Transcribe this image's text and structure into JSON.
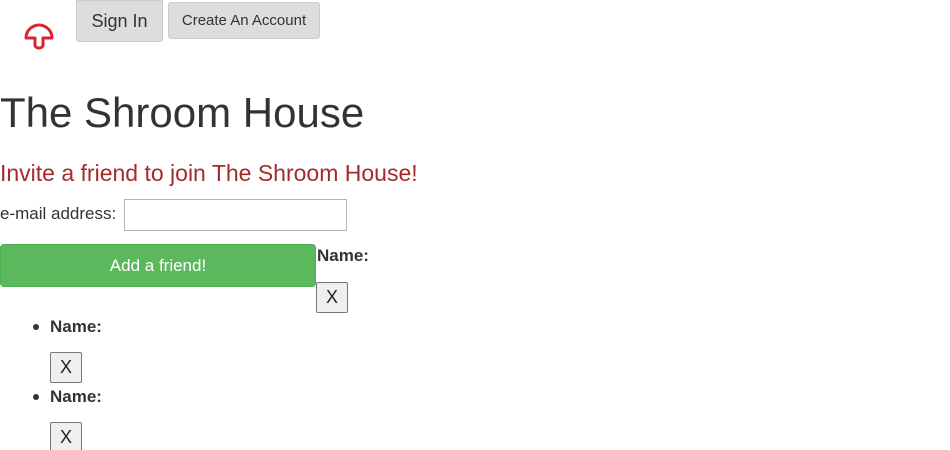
{
  "header": {
    "logo_icon": "mushroom-icon",
    "brand_color": "#d9262c",
    "sign_in_label": "Sign In",
    "create_account_label": "Create An Account"
  },
  "main": {
    "title": "The Shroom House",
    "invite_heading": "Invite a friend to join The Shroom House!",
    "invite_color": "#a52a2a",
    "email_label": "e-mail address:",
    "email_value": "",
    "add_friend_label": "Add a friend!",
    "add_friend_color": "#5cb85c"
  },
  "friends": {
    "first": {
      "name_label": "Name:",
      "remove_label": "X"
    },
    "items": [
      {
        "name_label": "Name:",
        "remove_label": "X"
      },
      {
        "name_label": "Name:",
        "remove_label": "X"
      }
    ]
  }
}
